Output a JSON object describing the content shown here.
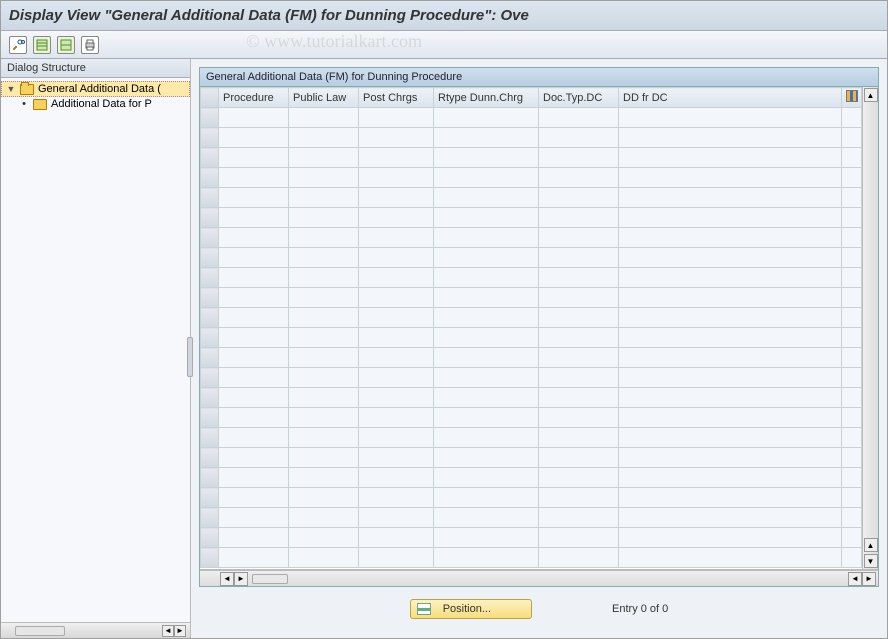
{
  "window": {
    "title": "Display View \"General Additional Data (FM) for Dunning Procedure\": Ove"
  },
  "toolbar": {
    "icons": [
      "toggle-edit-icon",
      "expand-all-icon",
      "collapse-all-icon",
      "print-icon"
    ]
  },
  "watermark": "© www.tutorialkart.com",
  "sidebar": {
    "header": "Dialog Structure",
    "nodes": {
      "root": {
        "label": "General Additional Data (",
        "selected": true
      },
      "child": {
        "label": "Additional Data for P"
      }
    }
  },
  "grid": {
    "title": "General Additional Data (FM) for Dunning Procedure",
    "columns": [
      "Procedure",
      "Public Law",
      "Post Chrgs",
      "Rtype Dunn.Chrg",
      "Doc.Typ.DC",
      "DD fr DC"
    ],
    "empty_rows": 23
  },
  "footer": {
    "position_label": "Position...",
    "entry_text": "Entry 0 of 0"
  }
}
